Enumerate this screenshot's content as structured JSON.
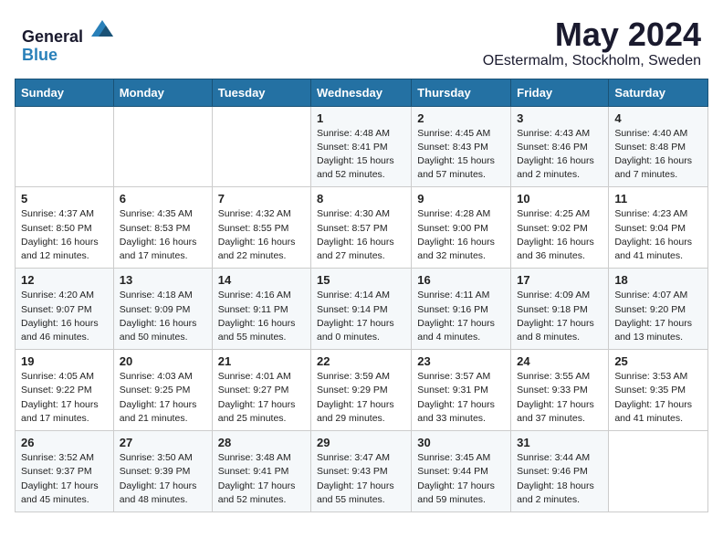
{
  "header": {
    "logo_general": "General",
    "logo_blue": "Blue",
    "title": "May 2024",
    "subtitle": "OEstermalm, Stockholm, Sweden"
  },
  "weekdays": [
    "Sunday",
    "Monday",
    "Tuesday",
    "Wednesday",
    "Thursday",
    "Friday",
    "Saturday"
  ],
  "weeks": [
    [
      {
        "day": "",
        "info": ""
      },
      {
        "day": "",
        "info": ""
      },
      {
        "day": "",
        "info": ""
      },
      {
        "day": "1",
        "info": "Sunrise: 4:48 AM\nSunset: 8:41 PM\nDaylight: 15 hours\nand 52 minutes."
      },
      {
        "day": "2",
        "info": "Sunrise: 4:45 AM\nSunset: 8:43 PM\nDaylight: 15 hours\nand 57 minutes."
      },
      {
        "day": "3",
        "info": "Sunrise: 4:43 AM\nSunset: 8:46 PM\nDaylight: 16 hours\nand 2 minutes."
      },
      {
        "day": "4",
        "info": "Sunrise: 4:40 AM\nSunset: 8:48 PM\nDaylight: 16 hours\nand 7 minutes."
      }
    ],
    [
      {
        "day": "5",
        "info": "Sunrise: 4:37 AM\nSunset: 8:50 PM\nDaylight: 16 hours\nand 12 minutes."
      },
      {
        "day": "6",
        "info": "Sunrise: 4:35 AM\nSunset: 8:53 PM\nDaylight: 16 hours\nand 17 minutes."
      },
      {
        "day": "7",
        "info": "Sunrise: 4:32 AM\nSunset: 8:55 PM\nDaylight: 16 hours\nand 22 minutes."
      },
      {
        "day": "8",
        "info": "Sunrise: 4:30 AM\nSunset: 8:57 PM\nDaylight: 16 hours\nand 27 minutes."
      },
      {
        "day": "9",
        "info": "Sunrise: 4:28 AM\nSunset: 9:00 PM\nDaylight: 16 hours\nand 32 minutes."
      },
      {
        "day": "10",
        "info": "Sunrise: 4:25 AM\nSunset: 9:02 PM\nDaylight: 16 hours\nand 36 minutes."
      },
      {
        "day": "11",
        "info": "Sunrise: 4:23 AM\nSunset: 9:04 PM\nDaylight: 16 hours\nand 41 minutes."
      }
    ],
    [
      {
        "day": "12",
        "info": "Sunrise: 4:20 AM\nSunset: 9:07 PM\nDaylight: 16 hours\nand 46 minutes."
      },
      {
        "day": "13",
        "info": "Sunrise: 4:18 AM\nSunset: 9:09 PM\nDaylight: 16 hours\nand 50 minutes."
      },
      {
        "day": "14",
        "info": "Sunrise: 4:16 AM\nSunset: 9:11 PM\nDaylight: 16 hours\nand 55 minutes."
      },
      {
        "day": "15",
        "info": "Sunrise: 4:14 AM\nSunset: 9:14 PM\nDaylight: 17 hours\nand 0 minutes."
      },
      {
        "day": "16",
        "info": "Sunrise: 4:11 AM\nSunset: 9:16 PM\nDaylight: 17 hours\nand 4 minutes."
      },
      {
        "day": "17",
        "info": "Sunrise: 4:09 AM\nSunset: 9:18 PM\nDaylight: 17 hours\nand 8 minutes."
      },
      {
        "day": "18",
        "info": "Sunrise: 4:07 AM\nSunset: 9:20 PM\nDaylight: 17 hours\nand 13 minutes."
      }
    ],
    [
      {
        "day": "19",
        "info": "Sunrise: 4:05 AM\nSunset: 9:22 PM\nDaylight: 17 hours\nand 17 minutes."
      },
      {
        "day": "20",
        "info": "Sunrise: 4:03 AM\nSunset: 9:25 PM\nDaylight: 17 hours\nand 21 minutes."
      },
      {
        "day": "21",
        "info": "Sunrise: 4:01 AM\nSunset: 9:27 PM\nDaylight: 17 hours\nand 25 minutes."
      },
      {
        "day": "22",
        "info": "Sunrise: 3:59 AM\nSunset: 9:29 PM\nDaylight: 17 hours\nand 29 minutes."
      },
      {
        "day": "23",
        "info": "Sunrise: 3:57 AM\nSunset: 9:31 PM\nDaylight: 17 hours\nand 33 minutes."
      },
      {
        "day": "24",
        "info": "Sunrise: 3:55 AM\nSunset: 9:33 PM\nDaylight: 17 hours\nand 37 minutes."
      },
      {
        "day": "25",
        "info": "Sunrise: 3:53 AM\nSunset: 9:35 PM\nDaylight: 17 hours\nand 41 minutes."
      }
    ],
    [
      {
        "day": "26",
        "info": "Sunrise: 3:52 AM\nSunset: 9:37 PM\nDaylight: 17 hours\nand 45 minutes."
      },
      {
        "day": "27",
        "info": "Sunrise: 3:50 AM\nSunset: 9:39 PM\nDaylight: 17 hours\nand 48 minutes."
      },
      {
        "day": "28",
        "info": "Sunrise: 3:48 AM\nSunset: 9:41 PM\nDaylight: 17 hours\nand 52 minutes."
      },
      {
        "day": "29",
        "info": "Sunrise: 3:47 AM\nSunset: 9:43 PM\nDaylight: 17 hours\nand 55 minutes."
      },
      {
        "day": "30",
        "info": "Sunrise: 3:45 AM\nSunset: 9:44 PM\nDaylight: 17 hours\nand 59 minutes."
      },
      {
        "day": "31",
        "info": "Sunrise: 3:44 AM\nSunset: 9:46 PM\nDaylight: 18 hours\nand 2 minutes."
      },
      {
        "day": "",
        "info": ""
      }
    ]
  ]
}
